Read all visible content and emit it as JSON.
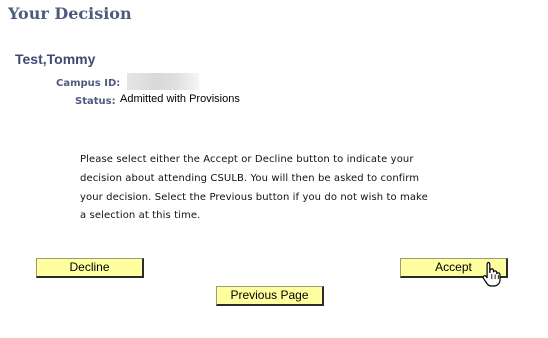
{
  "page": {
    "title": "Your Decision"
  },
  "student": {
    "name": "Test,Tommy",
    "campus_id_label": "Campus ID:",
    "status_label": "Status:",
    "status_value": "Admitted with Provisions"
  },
  "instructions": {
    "lines": [
      "Please select either the Accept or Decline button to indicate your",
      "decision about attending CSULB. You will then be asked to confirm",
      "your decision. Select the Previous button if you do not wish to make",
      "a selection at this time."
    ]
  },
  "buttons": {
    "decline": "Decline",
    "accept": "Accept",
    "previous": "Previous Page"
  },
  "cursor": {
    "icon": "hand-pointer-icon"
  },
  "colors": {
    "heading": "#4d5b7e",
    "button_fill": "#ffff9f"
  }
}
